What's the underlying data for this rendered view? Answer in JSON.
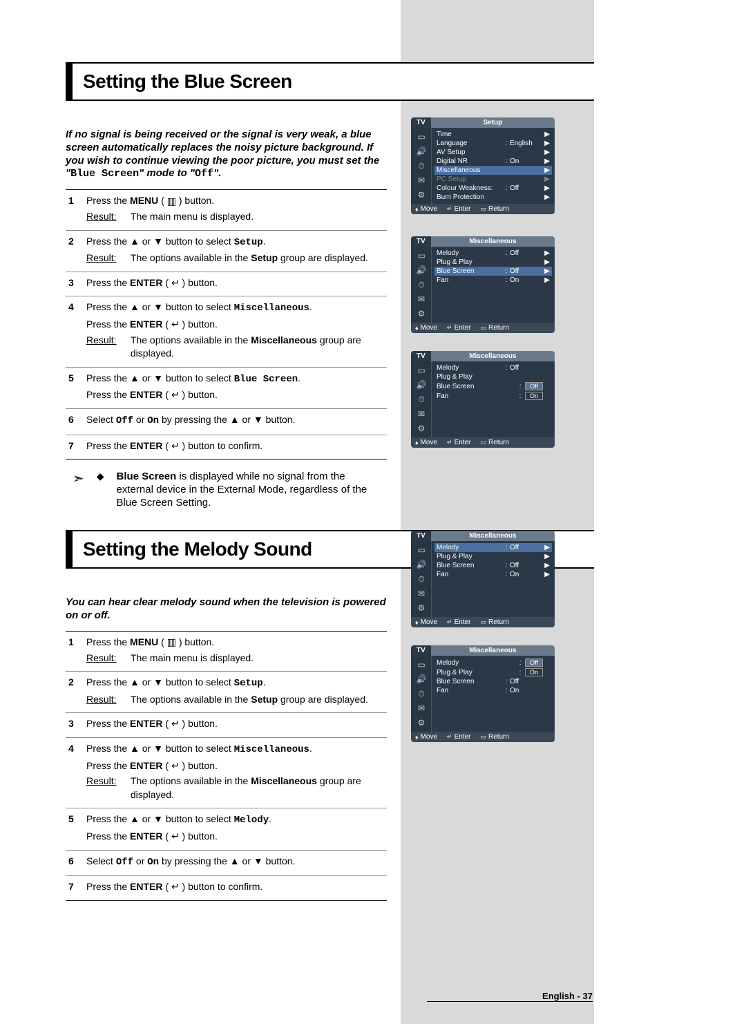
{
  "section1": {
    "title": "Setting the Blue Screen",
    "intro_pre": "If no signal is being received or the signal is very weak, a blue screen automatically replaces the noisy picture background. If you wish to continue viewing the poor picture, you must set the \"",
    "intro_mono1": "Blue Screen",
    "intro_mid": "\" mode to \"",
    "intro_mono2": "Off",
    "intro_post": "\".",
    "steps": {
      "s1": {
        "n": "1",
        "a": "Press the ",
        "b": "MENU",
        "c": " ( ",
        "d": " ) button.",
        "result_label": "Result:",
        "result": "The main menu is displayed."
      },
      "s2": {
        "n": "2",
        "a": "Press the ▲ or ▼ button to select ",
        "mono": "Setup",
        "b": ".",
        "result_label": "Result:",
        "r1": "The options available in the ",
        "rmono": "Setup",
        "r2": " group are displayed."
      },
      "s3": {
        "n": "3",
        "a": "Press the ",
        "b": "ENTER",
        "c": " ( ",
        "d": " ) button."
      },
      "s4": {
        "n": "4",
        "a": "Press the ▲ or ▼ button to select ",
        "mono": "Miscellaneous",
        "b": ".",
        "a2": "Press the ",
        "b2": "ENTER",
        "c2": " ( ",
        "d2": " ) button.",
        "result_label": "Result:",
        "r1": "The options available in the ",
        "rmono": "Miscellaneous",
        "r2": " group are displayed."
      },
      "s5": {
        "n": "5",
        "a": "Press the ▲ or ▼ button to select ",
        "mono": "Blue Screen",
        "b": ".",
        "a2": "Press the ",
        "b2": "ENTER",
        "c2": " ( ",
        "d2": " ) button."
      },
      "s6": {
        "n": "6",
        "a": "Select ",
        "mono1": "Off",
        "mid": " or ",
        "mono2": "On",
        "b": " by pressing the ▲ or ▼ button."
      },
      "s7": {
        "n": "7",
        "a": "Press the ",
        "b": "ENTER",
        "c": " ( ",
        "d": " ) button to confirm."
      }
    },
    "note_arrow": "➣",
    "note_dia": "◆",
    "note_b": "Blue Screen",
    "note_text": " is displayed while no signal from the external device in the External Mode, regardless of the Blue Screen Setting."
  },
  "section2": {
    "title": "Setting the Melody Sound",
    "intro": "You can hear clear melody sound when the television is powered on or off.",
    "steps": {
      "s1": {
        "n": "1",
        "a": "Press the ",
        "b": "MENU",
        "c": " ( ",
        "d": " ) button.",
        "result_label": "Result:",
        "result": "The main menu is displayed."
      },
      "s2": {
        "n": "2",
        "a": "Press the ▲ or ▼ button to select ",
        "mono": "Setup",
        "b": ".",
        "result_label": "Result:",
        "r1": "The options available in the ",
        "rmono": "Setup",
        "r2": " group are displayed."
      },
      "s3": {
        "n": "3",
        "a": "Press the ",
        "b": "ENTER",
        "c": " ( ",
        "d": " ) button."
      },
      "s4": {
        "n": "4",
        "a": "Press the ▲ or ▼ button to select ",
        "mono": "Miscellaneous",
        "b": ".",
        "a2": "Press the ",
        "b2": "ENTER",
        "c2": " ( ",
        "d2": " ) button.",
        "result_label": "Result:",
        "r1": "The options available in the ",
        "rmono": "Miscellaneous",
        "r2": " group are displayed."
      },
      "s5": {
        "n": "5",
        "a": "Press the ▲ or ▼ button to select ",
        "mono": "Melody",
        "b": ".",
        "a2": "Press the ",
        "b2": "ENTER",
        "c2": " ( ",
        "d2": " ) button."
      },
      "s6": {
        "n": "6",
        "a": "Select ",
        "mono1": "Off",
        "mid": " or ",
        "mono2": "On",
        "b": " by pressing the ▲ or ▼ button."
      },
      "s7": {
        "n": "7",
        "a": "Press the ",
        "b": "ENTER",
        "c": " ( ",
        "d": " ) button to confirm."
      }
    }
  },
  "osd": {
    "tv": "TV",
    "footer_move": "Move",
    "footer_enter": "Enter",
    "footer_return": "Return",
    "screen1": {
      "title": "Setup",
      "rows": [
        {
          "l": "Time",
          "v": "",
          "a": "▶"
        },
        {
          "l": "Language",
          "v": "English",
          "a": "▶"
        },
        {
          "l": "AV Setup",
          "v": "",
          "a": "▶"
        },
        {
          "l": "Digital NR",
          "v": "On",
          "a": "▶"
        },
        {
          "l": "Miscellaneous",
          "v": "",
          "a": "▶",
          "hl": true
        },
        {
          "l": "PC Setup",
          "v": "",
          "a": "▶",
          "dim": true
        },
        {
          "l": "Colour Weakness:",
          "v": "Off",
          "a": "▶"
        },
        {
          "l": "Burn Protection",
          "v": "",
          "a": "▶"
        }
      ]
    },
    "screen2": {
      "title": "Miscellaneous",
      "rows": [
        {
          "l": "Melody",
          "v": "Off",
          "a": "▶"
        },
        {
          "l": "Plug & Play",
          "v": "",
          "a": "▶"
        },
        {
          "l": "Blue Screen",
          "v": "Off",
          "a": "▶",
          "hl": true
        },
        {
          "l": "Fan",
          "v": "On",
          "a": "▶"
        }
      ]
    },
    "screen3": {
      "title": "Miscellaneous",
      "rows": [
        {
          "l": "Melody",
          "v": "Off",
          "a": ""
        },
        {
          "l": "Plug & Play",
          "v": "",
          "a": ""
        },
        {
          "l": "Blue Screen",
          "opts": [
            "Off"
          ],
          "sel": 0,
          "a": ""
        },
        {
          "l": "Fan",
          "opts": [
            "On"
          ],
          "a": ""
        }
      ]
    },
    "screen4": {
      "title": "Miscellaneous",
      "rows": [
        {
          "l": "Melody",
          "v": "Off",
          "a": "▶",
          "hl": true
        },
        {
          "l": "Plug & Play",
          "v": "",
          "a": "▶"
        },
        {
          "l": "Blue Screen",
          "v": "Off",
          "a": "▶"
        },
        {
          "l": "Fan",
          "v": "On",
          "a": "▶"
        }
      ]
    },
    "screen5": {
      "title": "Miscellaneous",
      "rows": [
        {
          "l": "Melody",
          "opts": [
            "Off"
          ],
          "sel": 0,
          "a": ""
        },
        {
          "l": "Plug & Play",
          "opts": [
            "On"
          ],
          "a": ""
        },
        {
          "l": "Blue Screen",
          "v": "Off",
          "a": ""
        },
        {
          "l": "Fan",
          "v": "On",
          "a": ""
        }
      ]
    }
  },
  "pagefoot": "English - 37"
}
